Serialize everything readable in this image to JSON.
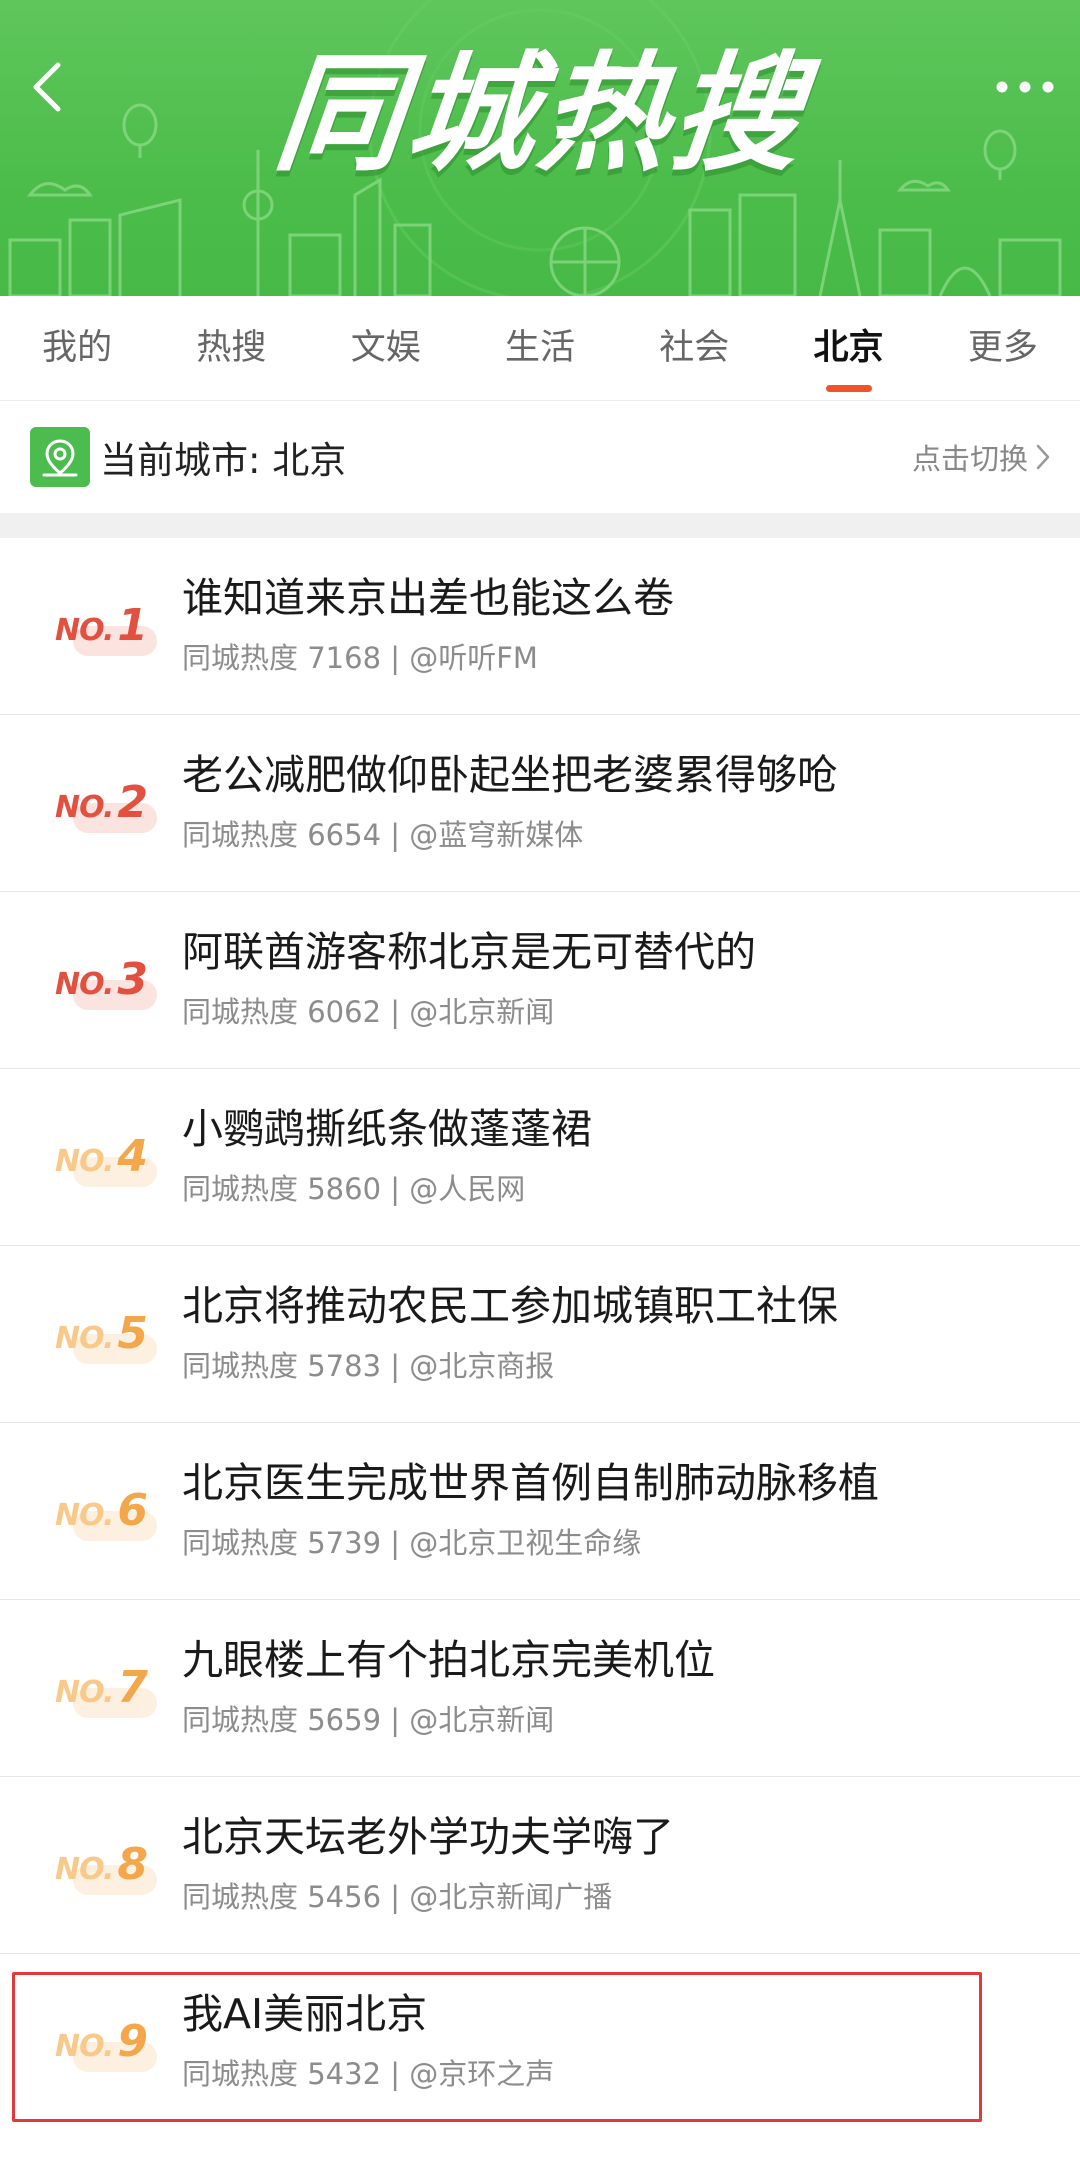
{
  "header": {
    "title": "同城热搜",
    "back_icon": "chevron-left-icon",
    "more_icon": "more-dots-icon"
  },
  "tabs": [
    {
      "label": "我的",
      "active": false
    },
    {
      "label": "热搜",
      "active": false
    },
    {
      "label": "文娱",
      "active": false
    },
    {
      "label": "生活",
      "active": false
    },
    {
      "label": "社会",
      "active": false
    },
    {
      "label": "北京",
      "active": true
    },
    {
      "label": "更多",
      "active": false
    }
  ],
  "city": {
    "label": "当前城市: 北京",
    "switch_label": "点击切换",
    "icon": "location-pin-icon"
  },
  "list": [
    {
      "rank": "1",
      "title": "谁知道来京出差也能这么卷",
      "meta": "同城热度 7168 | @听听FM"
    },
    {
      "rank": "2",
      "title": "老公减肥做仰卧起坐把老婆累得够呛",
      "meta": "同城热度 6654 | @蓝穹新媒体"
    },
    {
      "rank": "3",
      "title": "阿联酋游客称北京是无可替代的",
      "meta": "同城热度 6062 | @北京新闻"
    },
    {
      "rank": "4",
      "title": "小鹦鹉撕纸条做蓬蓬裙",
      "meta": "同城热度 5860 | @人民网"
    },
    {
      "rank": "5",
      "title": "北京将推动农民工参加城镇职工社保",
      "meta": "同城热度 5783 | @北京商报"
    },
    {
      "rank": "6",
      "title": "北京医生完成世界首例自制肺动脉移植",
      "meta": "同城热度 5739 | @北京卫视生命缘"
    },
    {
      "rank": "7",
      "title": "九眼楼上有个拍北京完美机位",
      "meta": "同城热度 5659 | @北京新闻"
    },
    {
      "rank": "8",
      "title": "北京天坛老外学功夫学嗨了",
      "meta": "同城热度 5456 | @北京新闻广播"
    },
    {
      "rank": "9",
      "title": "我AI美丽北京",
      "meta": "同城热度 5432 | @京环之声"
    }
  ],
  "rank_prefix": "NO.",
  "colors": {
    "banner_green": "#4cbd4b",
    "tab_active_underline": "#f0532b",
    "rank_hot": "#e2503f",
    "rank_warm": "#f4a64a",
    "highlight_border": "#e03a3a"
  }
}
